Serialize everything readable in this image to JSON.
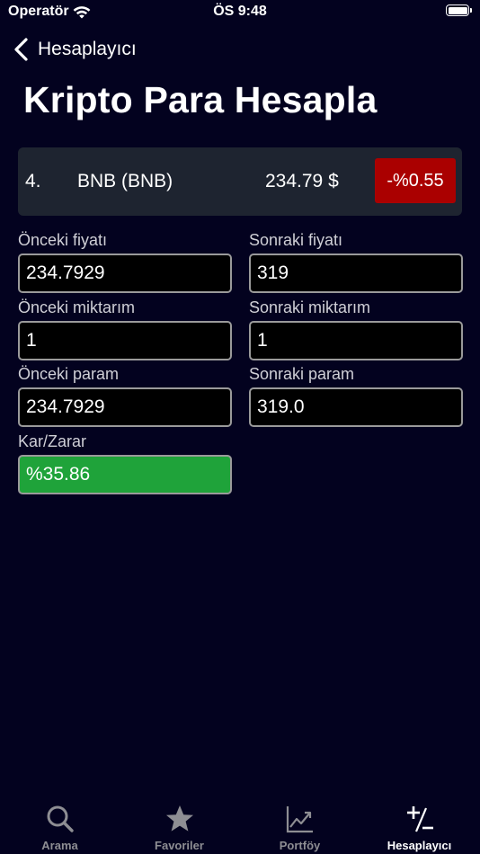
{
  "status_bar": {
    "carrier": "Operatör",
    "time": "ÖS 9:48"
  },
  "nav": {
    "back_label": "Hesaplayıcı"
  },
  "page": {
    "title": "Kripto Para Hesapla"
  },
  "coin": {
    "rank": "4.",
    "name": "BNB (BNB)",
    "price": "234.79 $",
    "change": "-%0.55",
    "change_color": "#aa0000"
  },
  "fields": {
    "prev_price": {
      "label": "Önceki fiyatı",
      "value": "234.7929"
    },
    "next_price": {
      "label": "Sonraki fiyatı",
      "value": "319"
    },
    "prev_amount": {
      "label": "Önceki miktarım",
      "value": "1"
    },
    "next_amount": {
      "label": "Sonraki miktarım",
      "value": "1"
    },
    "prev_money": {
      "label": "Önceki param",
      "value": "234.7929"
    },
    "next_money": {
      "label": "Sonraki param",
      "value": "319.0"
    },
    "profit_loss": {
      "label": "Kar/Zarar",
      "value": "%35.86",
      "color": "#1fa33a"
    }
  },
  "tabs": [
    {
      "label": "Arama",
      "icon": "search-icon"
    },
    {
      "label": "Favoriler",
      "icon": "star-icon"
    },
    {
      "label": "Portföy",
      "icon": "chart-icon"
    },
    {
      "label": "Hesaplayıcı",
      "icon": "plus-minus-icon"
    }
  ],
  "colors": {
    "background": "#03021f",
    "card": "#1e2430",
    "tab_inactive": "#8e8e93",
    "tab_active": "#ffffff"
  }
}
